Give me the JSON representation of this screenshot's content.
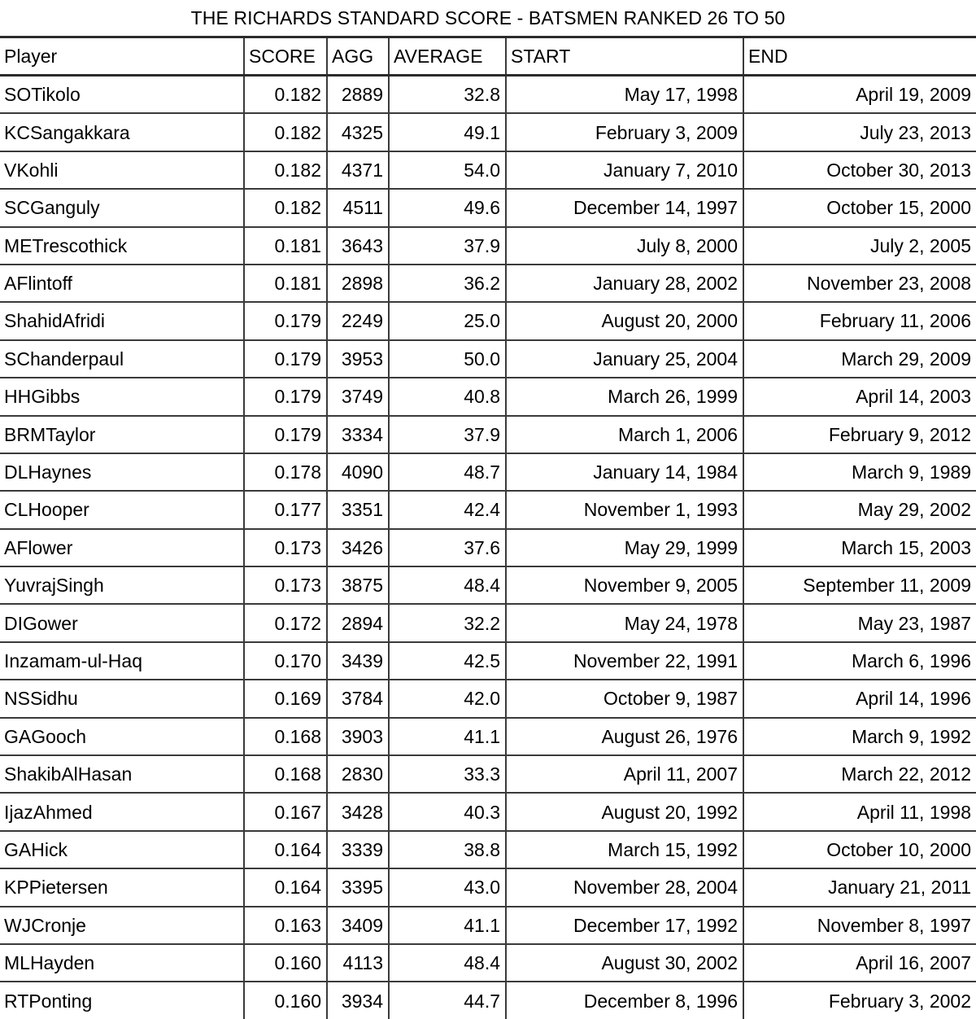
{
  "table": {
    "title": "THE RICHARDS STANDARD SCORE - BATSMEN RANKED 26 TO 50",
    "columns": [
      {
        "key": "player",
        "label": "Player"
      },
      {
        "key": "score",
        "label": "SCORE"
      },
      {
        "key": "agg",
        "label": "AGG"
      },
      {
        "key": "average",
        "label": "AVERAGE"
      },
      {
        "key": "start",
        "label": "START"
      },
      {
        "key": "end",
        "label": "END"
      }
    ],
    "rows": [
      {
        "player": "SOTikolo",
        "score": "0.182",
        "agg": "2889",
        "average": "32.8",
        "start": "May 17, 1998",
        "end": "April 19, 2009"
      },
      {
        "player": "KCSangakkara",
        "score": "0.182",
        "agg": "4325",
        "average": "49.1",
        "start": "February 3, 2009",
        "end": "July 23, 2013"
      },
      {
        "player": "VKohli",
        "score": "0.182",
        "agg": "4371",
        "average": "54.0",
        "start": "January 7, 2010",
        "end": "October 30, 2013"
      },
      {
        "player": "SCGanguly",
        "score": "0.182",
        "agg": "4511",
        "average": "49.6",
        "start": "December 14, 1997",
        "end": "October 15, 2000"
      },
      {
        "player": "METrescothick",
        "score": "0.181",
        "agg": "3643",
        "average": "37.9",
        "start": "July 8, 2000",
        "end": "July 2, 2005"
      },
      {
        "player": "AFlintoff",
        "score": "0.181",
        "agg": "2898",
        "average": "36.2",
        "start": "January 28, 2002",
        "end": "November 23, 2008"
      },
      {
        "player": "ShahidAfridi",
        "score": "0.179",
        "agg": "2249",
        "average": "25.0",
        "start": "August 20, 2000",
        "end": "February 11, 2006"
      },
      {
        "player": "SChanderpaul",
        "score": "0.179",
        "agg": "3953",
        "average": "50.0",
        "start": "January 25, 2004",
        "end": "March 29, 2009"
      },
      {
        "player": "HHGibbs",
        "score": "0.179",
        "agg": "3749",
        "average": "40.8",
        "start": "March 26, 1999",
        "end": "April 14, 2003"
      },
      {
        "player": "BRMTaylor",
        "score": "0.179",
        "agg": "3334",
        "average": "37.9",
        "start": "March 1, 2006",
        "end": "February 9, 2012"
      },
      {
        "player": "DLHaynes",
        "score": "0.178",
        "agg": "4090",
        "average": "48.7",
        "start": "January 14, 1984",
        "end": "March 9, 1989"
      },
      {
        "player": "CLHooper",
        "score": "0.177",
        "agg": "3351",
        "average": "42.4",
        "start": "November 1, 1993",
        "end": "May 29, 2002"
      },
      {
        "player": "AFlower",
        "score": "0.173",
        "agg": "3426",
        "average": "37.6",
        "start": "May 29, 1999",
        "end": "March 15, 2003"
      },
      {
        "player": "YuvrajSingh",
        "score": "0.173",
        "agg": "3875",
        "average": "48.4",
        "start": "November 9, 2005",
        "end": "September 11, 2009"
      },
      {
        "player": "DIGower",
        "score": "0.172",
        "agg": "2894",
        "average": "32.2",
        "start": "May 24, 1978",
        "end": "May 23, 1987"
      },
      {
        "player": "Inzamam-ul-Haq",
        "score": "0.170",
        "agg": "3439",
        "average": "42.5",
        "start": "November 22, 1991",
        "end": "March 6, 1996"
      },
      {
        "player": "NSSidhu",
        "score": "0.169",
        "agg": "3784",
        "average": "42.0",
        "start": "October 9, 1987",
        "end": "April 14, 1996"
      },
      {
        "player": "GAGooch",
        "score": "0.168",
        "agg": "3903",
        "average": "41.1",
        "start": "August 26, 1976",
        "end": "March 9, 1992"
      },
      {
        "player": "ShakibAlHasan",
        "score": "0.168",
        "agg": "2830",
        "average": "33.3",
        "start": "April 11, 2007",
        "end": "March 22, 2012"
      },
      {
        "player": "IjazAhmed",
        "score": "0.167",
        "agg": "3428",
        "average": "40.3",
        "start": "August 20, 1992",
        "end": "April 11, 1998"
      },
      {
        "player": "GAHick",
        "score": "0.164",
        "agg": "3339",
        "average": "38.8",
        "start": "March 15, 1992",
        "end": "October 10, 2000"
      },
      {
        "player": "KPPietersen",
        "score": "0.164",
        "agg": "3395",
        "average": "43.0",
        "start": "November 28, 2004",
        "end": "January 21, 2011"
      },
      {
        "player": "WJCronje",
        "score": "0.163",
        "agg": "3409",
        "average": "41.1",
        "start": "December 17, 1992",
        "end": "November 8, 1997"
      },
      {
        "player": "MLHayden",
        "score": "0.160",
        "agg": "4113",
        "average": "48.4",
        "start": "August 30, 2002",
        "end": "April 16, 2007"
      },
      {
        "player": "RTPonting",
        "score": "0.160",
        "agg": "3934",
        "average": "44.7",
        "start": "December 8, 1996",
        "end": "February 3, 2002"
      }
    ]
  }
}
